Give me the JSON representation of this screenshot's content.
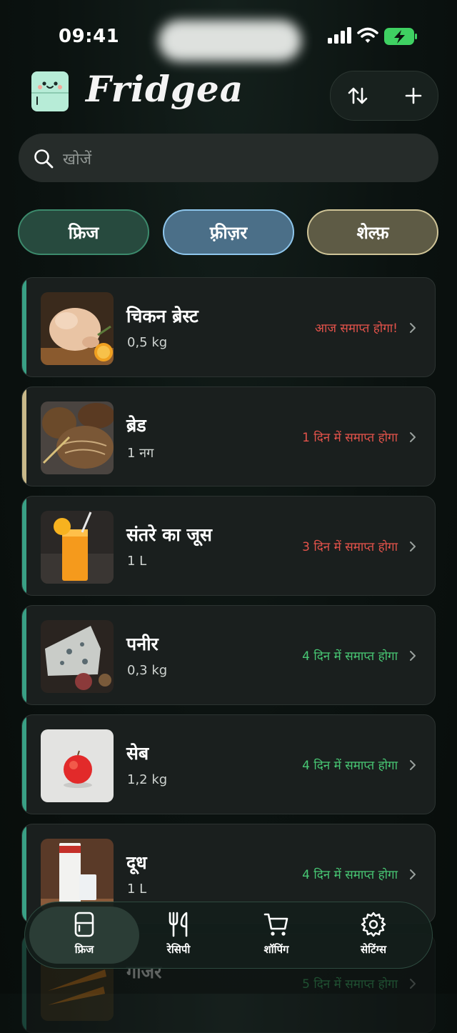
{
  "status": {
    "time": "09:41"
  },
  "app": {
    "title": "Fridgea"
  },
  "search": {
    "placeholder": "खोजें"
  },
  "tabs": [
    {
      "label": "फ्रिज",
      "color": "#274a3e"
    },
    {
      "label": "फ़्रीज़र",
      "color": "#4b6f88"
    },
    {
      "label": "शेल्फ़",
      "color": "#5e5b45"
    }
  ],
  "items": [
    {
      "name": "चिकन ब्रेस्ट",
      "qty": "0,5 kg",
      "expiry": "आज समाप्त होगा!",
      "status": "red",
      "accent": "#39a085",
      "image": "chicken"
    },
    {
      "name": "ब्रेड",
      "qty": "1 नग",
      "expiry": "1 दिन में समाप्त होगा",
      "status": "red",
      "accent": "#c9b98a",
      "image": "bread"
    },
    {
      "name": "संतरे का जूस",
      "qty": "1 L",
      "expiry": "3 दिन में समाप्त होगा",
      "status": "red",
      "accent": "#39a085",
      "image": "orange-juice"
    },
    {
      "name": "पनीर",
      "qty": "0,3 kg",
      "expiry": "4 दिन में समाप्त होगा",
      "status": "green",
      "accent": "#39a085",
      "image": "cheese"
    },
    {
      "name": "सेब",
      "qty": "1,2 kg",
      "expiry": "4 दिन में समाप्त होगा",
      "status": "green",
      "accent": "#39a085",
      "image": "apple"
    },
    {
      "name": "दूध",
      "qty": "1 L",
      "expiry": "4 दिन में समाप्त होगा",
      "status": "green",
      "accent": "#39a085",
      "image": "milk"
    },
    {
      "name": "गाजर",
      "qty": "",
      "expiry": "5 दिन में समाप्त होगा",
      "status": "green",
      "accent": "#39a085",
      "image": "carrot"
    }
  ],
  "nav": [
    {
      "label": "फ्रिज",
      "icon": "fridge-icon",
      "active": true
    },
    {
      "label": "रेसिपी",
      "icon": "fork-knife-icon",
      "active": false
    },
    {
      "label": "शॉपिंग",
      "icon": "cart-icon",
      "active": false
    },
    {
      "label": "सेटिंग्स",
      "icon": "gear-icon",
      "active": false
    }
  ],
  "colors": {
    "accent": "#39a085",
    "warning": "#e5534b",
    "ok": "#48c774"
  }
}
